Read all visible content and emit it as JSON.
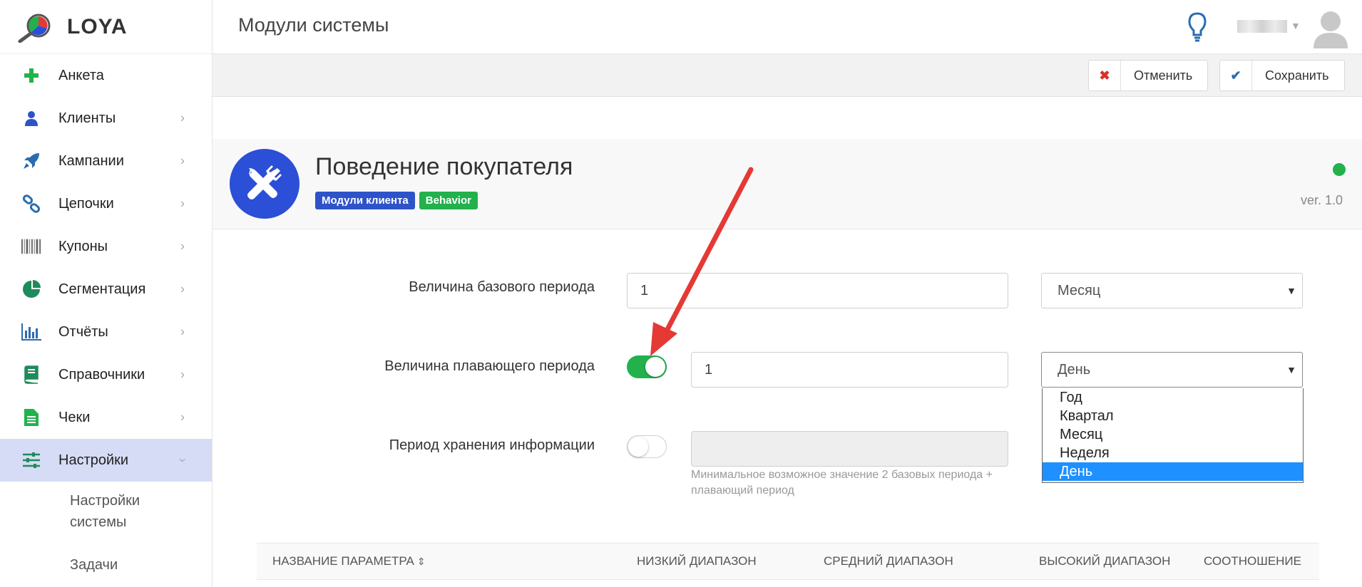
{
  "app": {
    "logo_text": "LOYA"
  },
  "header": {
    "title": "Модули системы"
  },
  "sidebar": {
    "items": [
      {
        "label": "Анкета",
        "icon": "plus-icon",
        "has_chevron": false
      },
      {
        "label": "Клиенты",
        "icon": "user-icon",
        "has_chevron": true
      },
      {
        "label": "Кампании",
        "icon": "rocket-icon",
        "has_chevron": true
      },
      {
        "label": "Цепочки",
        "icon": "link-icon",
        "has_chevron": true
      },
      {
        "label": "Купоны",
        "icon": "barcode-icon",
        "has_chevron": true
      },
      {
        "label": "Сегментация",
        "icon": "pie-chart-icon",
        "has_chevron": true
      },
      {
        "label": "Отчёты",
        "icon": "bar-chart-icon",
        "has_chevron": true
      },
      {
        "label": "Справочники",
        "icon": "book-icon",
        "has_chevron": true
      },
      {
        "label": "Чеки",
        "icon": "receipt-icon",
        "has_chevron": true
      },
      {
        "label": "Настройки",
        "icon": "sliders-icon",
        "has_chevron": true,
        "active": true
      }
    ],
    "sub_items": [
      {
        "label": "Настройки системы"
      },
      {
        "label": "Задачи"
      }
    ]
  },
  "toolbar": {
    "cancel_label": "Отменить",
    "save_label": "Сохранить"
  },
  "module": {
    "title": "Поведение покупателя",
    "badges": [
      "Модули клиента",
      "Behavior"
    ],
    "version": "ver. 1.0",
    "status_color": "#22b14c"
  },
  "form": {
    "base_period": {
      "label": "Величина базового периода",
      "value": "1",
      "unit": "Месяц"
    },
    "floating_period": {
      "label": "Величина плавающего периода",
      "enabled": true,
      "value": "1",
      "unit": "День"
    },
    "storage_period": {
      "label": "Период хранения информации",
      "enabled": false,
      "value": "",
      "hint": "Минимальное возможное значение 2 базовых периода + плавающий период"
    }
  },
  "dropdown": {
    "options": [
      "Год",
      "Квартал",
      "Месяц",
      "Неделя",
      "День"
    ],
    "selected": "День"
  },
  "table": {
    "columns": [
      "НАЗВАНИЕ ПАРАМЕТРА",
      "НИЗКИЙ ДИАПАЗОН",
      "СРЕДНИЙ ДИАПАЗОН",
      "ВЫСОКИЙ ДИАПАЗОН",
      "СООТНОШЕНИЕ"
    ]
  },
  "colors": {
    "accent": "#2b4fd6",
    "success": "#22b14c",
    "annotation": "#e53935",
    "selected_option": "#1e90ff"
  }
}
